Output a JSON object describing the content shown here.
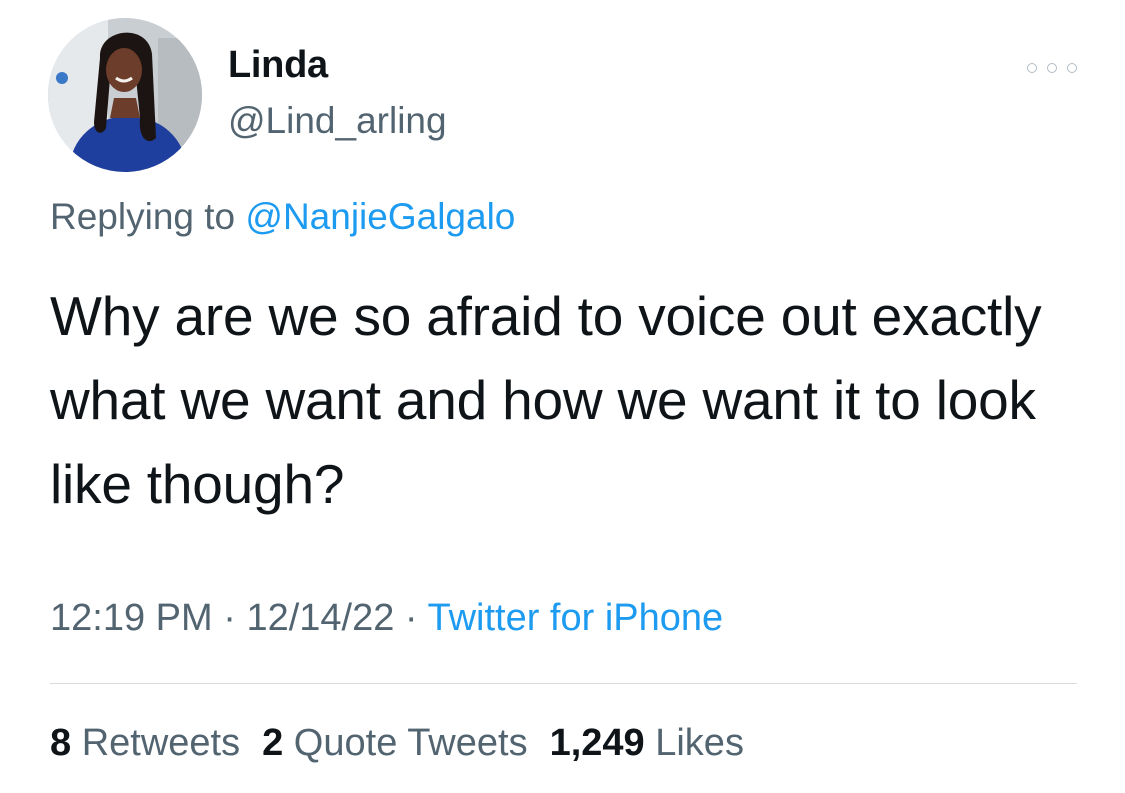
{
  "author": {
    "name": "Linda",
    "handle": "@Lind_arling"
  },
  "reply": {
    "prefix": "Replying to ",
    "mention": "@NanjieGalgalo"
  },
  "tweet": {
    "text": "Why are we so afraid to voice out exactly what we want and how we want it to look like though?"
  },
  "meta": {
    "time": "12:19 PM",
    "sep1": " · ",
    "date": "12/14/22",
    "sep2": " · ",
    "source": "Twitter for iPhone"
  },
  "stats": {
    "retweets_count": "8",
    "retweets_label": " Retweets",
    "quotes_count": "2",
    "quotes_label": " Quote Tweets",
    "likes_count": "1,249",
    "likes_label": " Likes"
  },
  "colors": {
    "link": "#1d9bf0",
    "secondary_text": "#536471",
    "primary_text": "#0f1419"
  },
  "icons": {
    "more": "more-horizontal-icon"
  }
}
